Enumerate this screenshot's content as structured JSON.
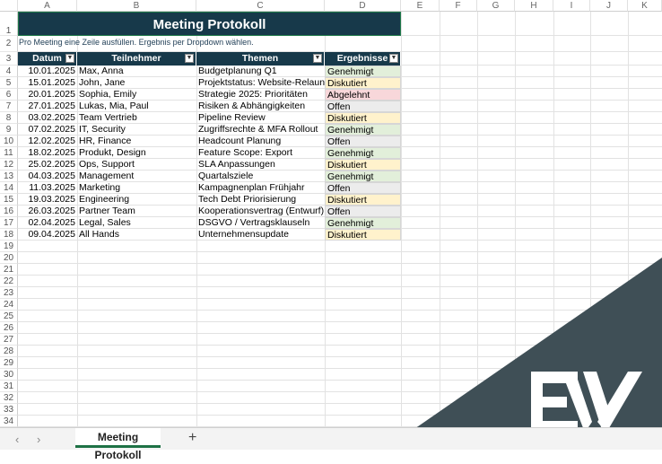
{
  "columns": [
    "A",
    "B",
    "C",
    "D",
    "E",
    "F",
    "G",
    "H",
    "I",
    "J",
    "K"
  ],
  "rows": [
    "1",
    "2",
    "3",
    "4",
    "5",
    "6",
    "7",
    "8",
    "9",
    "10",
    "11",
    "12",
    "13",
    "14",
    "15",
    "16",
    "17",
    "18",
    "19",
    "20",
    "21",
    "22",
    "23",
    "24",
    "25",
    "26",
    "27",
    "28",
    "29",
    "30",
    "31",
    "32",
    "33",
    "34"
  ],
  "title": "Meeting Protokoll",
  "subtitle": "Pro Meeting eine Zeile ausfüllen. Ergebnis per Dropdown wählen.",
  "headers": [
    "Datum",
    "Teilnehmer",
    "Themen",
    "Ergebnisse"
  ],
  "filter_icon": "dropdown-arrow",
  "table": [
    [
      "10.01.2025",
      "Max, Anna",
      "Budgetplanung Q1",
      "Genehmigt"
    ],
    [
      "15.01.2025",
      "John, Jane",
      "Projektstatus: Website-Relaunch",
      "Diskutiert"
    ],
    [
      "20.01.2025",
      "Sophia, Emily",
      "Strategie 2025: Prioritäten",
      "Abgelehnt"
    ],
    [
      "27.01.2025",
      "Lukas, Mia, Paul",
      "Risiken & Abhängigkeiten",
      "Offen"
    ],
    [
      "03.02.2025",
      "Team Vertrieb",
      "Pipeline Review",
      "Diskutiert"
    ],
    [
      "07.02.2025",
      "IT, Security",
      "Zugriffsrechte & MFA Rollout",
      "Genehmigt"
    ],
    [
      "12.02.2025",
      "HR, Finance",
      "Headcount Planung",
      "Offen"
    ],
    [
      "18.02.2025",
      "Produkt, Design",
      "Feature Scope: Export",
      "Genehmigt"
    ],
    [
      "25.02.2025",
      "Ops, Support",
      "SLA Anpassungen",
      "Diskutiert"
    ],
    [
      "04.03.2025",
      "Management",
      "Quartalsziele",
      "Genehmigt"
    ],
    [
      "11.03.2025",
      "Marketing",
      "Kampagnenplan Frühjahr",
      "Offen"
    ],
    [
      "19.03.2025",
      "Engineering",
      "Tech Debt Priorisierung",
      "Diskutiert"
    ],
    [
      "26.03.2025",
      "Partner Team",
      "Kooperationsvertrag (Entwurf)",
      "Offen"
    ],
    [
      "02.04.2025",
      "Legal, Sales",
      "DSGVO / Vertragsklauseln",
      "Genehmigt"
    ],
    [
      "09.04.2025",
      "All Hands",
      "Unternehmensupdate",
      "Diskutiert"
    ]
  ],
  "status_colors": {
    "Genehmigt": "#e2efda",
    "Diskutiert": "#fff2cc",
    "Abgelehnt": "#f8d7da",
    "Offen": "#ececec"
  },
  "header_color": "#17394a",
  "overlay_color": "#3f4f56",
  "tab": {
    "label": "Meeting Protokoll",
    "add": "+",
    "prev": "‹",
    "next": "›"
  },
  "logo": "EW"
}
